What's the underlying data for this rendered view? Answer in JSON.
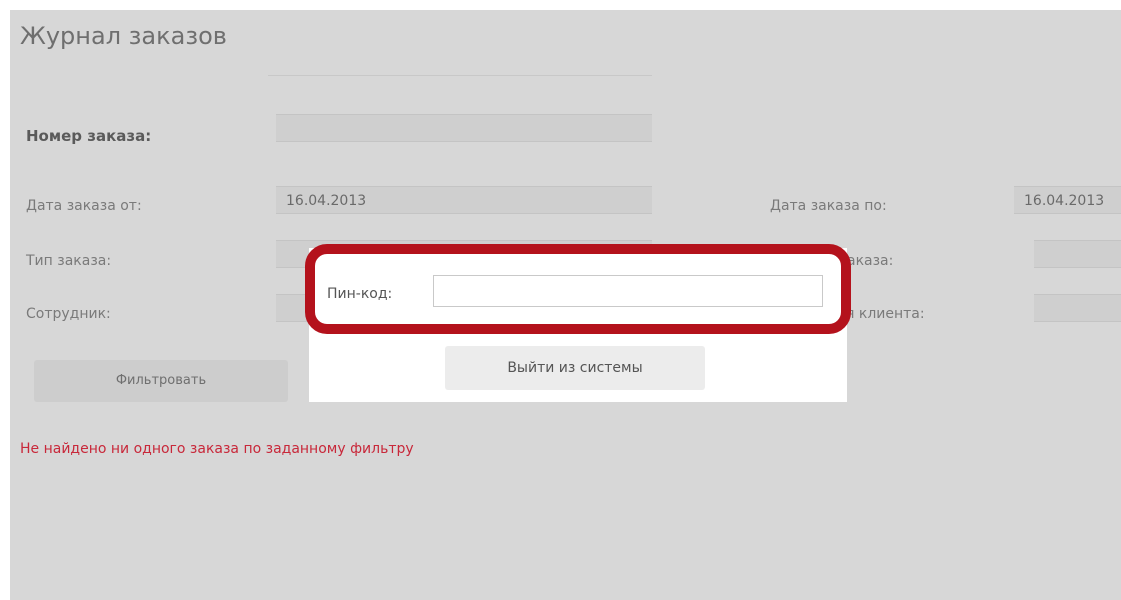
{
  "page": {
    "title": "Журнал заказов",
    "order_number_label": "Номер заказа:",
    "date_from_label": "Дата заказа от:",
    "date_from_value": "16.04.2013",
    "date_to_label": "Дата заказа по:",
    "date_to_value": "16.04.2013",
    "order_type_label": "Тип заказа:",
    "order_status_label_partial": "аказа:",
    "employee_label": "Сотрудник:",
    "client_label_partial": "я клиента:",
    "filter_button": "Фильтровать",
    "error_message": "Не найдено ни одного заказа по заданному фильтру"
  },
  "modal": {
    "pin_label": "Пин-код:",
    "pin_value": "",
    "logout_button": "Выйти из системы",
    "highlight_color": "#b4121c"
  },
  "colors": {
    "overlay_bg": "#d7d7d7",
    "error_text": "#c8283a"
  }
}
